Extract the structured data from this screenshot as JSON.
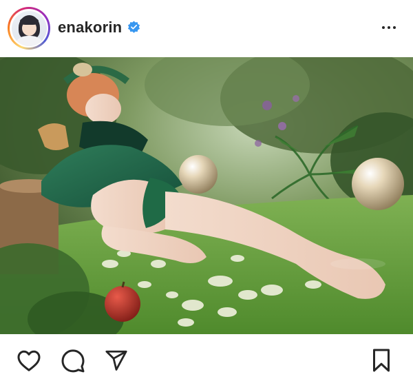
{
  "post": {
    "username": "enakorin",
    "verified": true,
    "avatar_icon": "profile-avatar",
    "more_icon": "more-horizontal-icon"
  },
  "photo": {
    "description_icon": "cosplay-photo"
  },
  "actions": {
    "like_icon": "heart-icon",
    "comment_icon": "comment-icon",
    "share_icon": "send-icon",
    "save_icon": "bookmark-icon"
  },
  "colors": {
    "text": "#262626",
    "verified_blue": "#3897f0",
    "background": "#ffffff"
  }
}
